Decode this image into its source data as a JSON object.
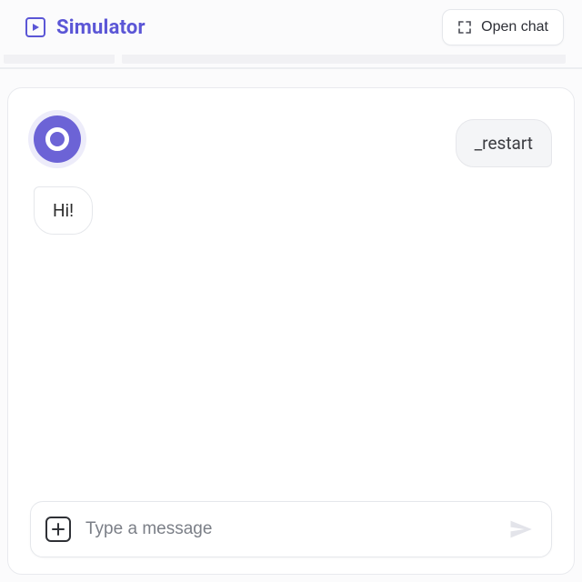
{
  "header": {
    "title": "Simulator",
    "open_chat_label": "Open chat"
  },
  "chat": {
    "restart_label": "_restart",
    "messages": [
      {
        "from": "bot",
        "text": "Hi!"
      }
    ]
  },
  "composer": {
    "placeholder": "Type a message"
  }
}
